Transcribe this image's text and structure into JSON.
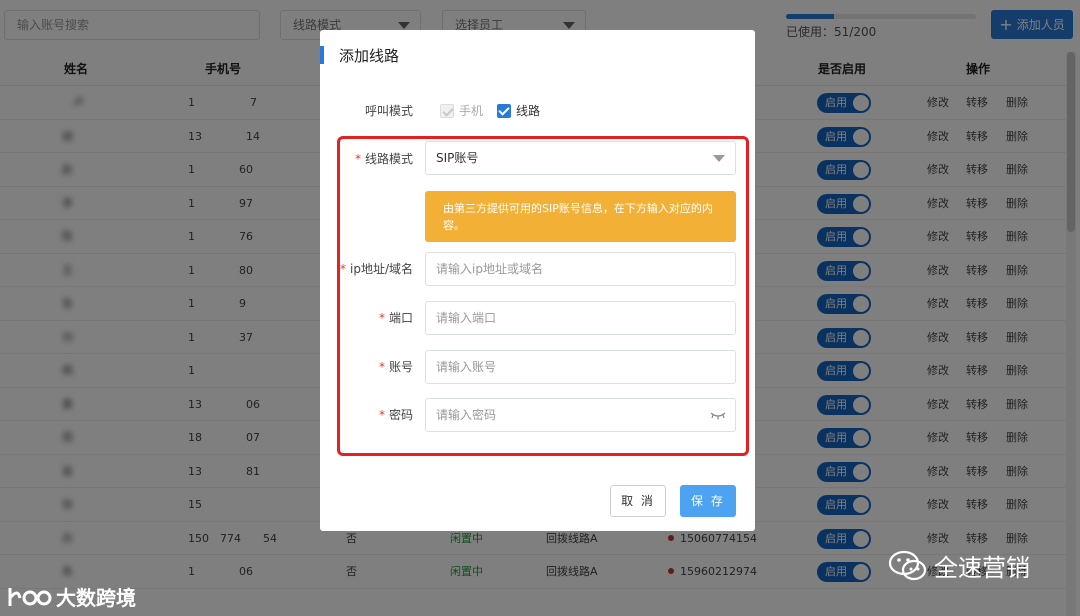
{
  "toolbar": {
    "search_placeholder": "输入账号搜索",
    "line_mode_select": "线路模式",
    "employee_select": "选择员工",
    "usage_label": "已使用：51/200",
    "usage_fraction": 0.255,
    "add_button": "添加人员"
  },
  "table": {
    "headers": {
      "name": "姓名",
      "phone": "手机号",
      "enabled": "是否启用",
      "actions": "操作"
    },
    "rows": [
      {
        "name": "　卢",
        "phone": "1　　　　　7"
      },
      {
        "name": "胡　　",
        "phone": "13　　　　14"
      },
      {
        "name": "赵",
        "phone": "1　　　　60"
      },
      {
        "name": "李",
        "phone": "1　　　　97"
      },
      {
        "name": "陈",
        "phone": "1　　　　76"
      },
      {
        "name": "王　",
        "phone": "1　　　　80"
      },
      {
        "name": "张",
        "phone": "1　　　　9"
      },
      {
        "name": "刘",
        "phone": "1　　　　37"
      },
      {
        "name": "杨",
        "phone": "1　　　　　"
      },
      {
        "name": "黄",
        "phone": "13　　　　06"
      },
      {
        "name": "周",
        "phone": "18　　　　07"
      },
      {
        "name": "吴",
        "phone": "13　　　　81"
      },
      {
        "name": "徐",
        "phone": "15　　　　　"
      },
      {
        "name": "孙",
        "phone": "150　774　　54",
        "col3": "否",
        "status": "闲置中",
        "line": "回拨线路A",
        "callee": "15060774154"
      },
      {
        "name": "朱",
        "phone": "1　　　　06",
        "col3": "否",
        "status": "闲置中",
        "line": "回拨线路A",
        "callee": "15960212974"
      }
    ],
    "toggle_label": "启用",
    "action_edit": "修改",
    "action_transfer": "转移",
    "action_delete": "删除"
  },
  "modal": {
    "title": "添加线路",
    "call_mode_label": "呼叫模式",
    "call_mode_phone": "手机",
    "call_mode_line": "线路",
    "line_mode_label": "线路模式",
    "line_mode_value": "SIP账号",
    "notice": "由第三方提供可用的SIP账号信息，在下方输入对应的内容。",
    "ip_label": "ip地址/域名",
    "ip_placeholder": "请输入ip地址或域名",
    "port_label": "端口",
    "port_placeholder": "请输入端口",
    "account_label": "账号",
    "account_placeholder": "请输入账号",
    "password_label": "密码",
    "password_placeholder": "请输入密码",
    "cancel": "取 消",
    "save": "保 存"
  },
  "watermarks": {
    "left": "大数跨境",
    "right": "全速营销"
  }
}
